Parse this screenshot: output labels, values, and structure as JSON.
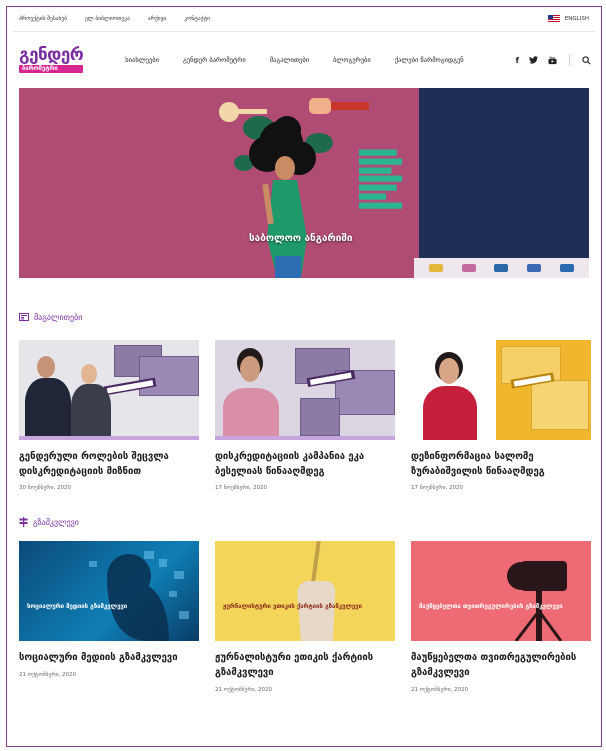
{
  "topbar": {
    "links": [
      "პროექტის შესახებ",
      "ელ ბიბლიოთეკა",
      "არქივი",
      "კონტაქტი"
    ],
    "language": "ENGLISH"
  },
  "header": {
    "logo_line1": "გენდერ",
    "logo_line2": "ბარომეტრი",
    "nav": [
      "სიახლეები",
      "გენდერ ბარომეტრი",
      "მაგალითები",
      "ბლოგერები",
      "ქალები წარმოგიდგენ"
    ],
    "social_icons": [
      "facebook-icon",
      "twitter-icon",
      "youtube-icon",
      "search-icon"
    ]
  },
  "hero": {
    "caption": "საბოლოო ანგარიში",
    "colors": {
      "background": "#b04c74",
      "panel": "#1f2e55",
      "text": "#2bb58e"
    }
  },
  "sections": {
    "examples": {
      "title": "მაგალითები",
      "items": [
        {
          "title": "გენდერული როლების შეცვლა დისკრედიტაციის მიზნით",
          "date": "30 ნოემბერი, 2020"
        },
        {
          "title": "დისკრედიტაციის კამპანია ეკა ბესელიას წინააღმდეგ",
          "date": "17 ნოემბერი, 2020"
        },
        {
          "title": "დეზინფორმაცია სალომე ზურაბიშვილის წინააღმდეგ",
          "date": "17 ნოემბერი, 2020"
        }
      ]
    },
    "guides": {
      "title": "გზამკვლევი",
      "items": [
        {
          "title": "სოციალური მედიის გზამკვლევი",
          "date": "21 ოქტომბერი, 2020",
          "thumb_text": "სოციალური მედიის გზამკვლევი"
        },
        {
          "title": "ჟურნალისტური ეთიკის ქარტიის გზამკვლევი",
          "date": "21 ოქტომბერი, 2020",
          "thumb_text": "ჟურნალისტური ეთიკის ქარტიის გზამკვლევი"
        },
        {
          "title": "მაუწყებელთა თვითრეგულირების გზამკვლევი",
          "date": "21 ოქტომბერი, 2020",
          "thumb_text": "მაუწყებელთა თვითრეგულირების გზამკვლევი"
        }
      ]
    }
  },
  "colors": {
    "brand": "#7a2ea0",
    "accent": "#d6268f"
  }
}
